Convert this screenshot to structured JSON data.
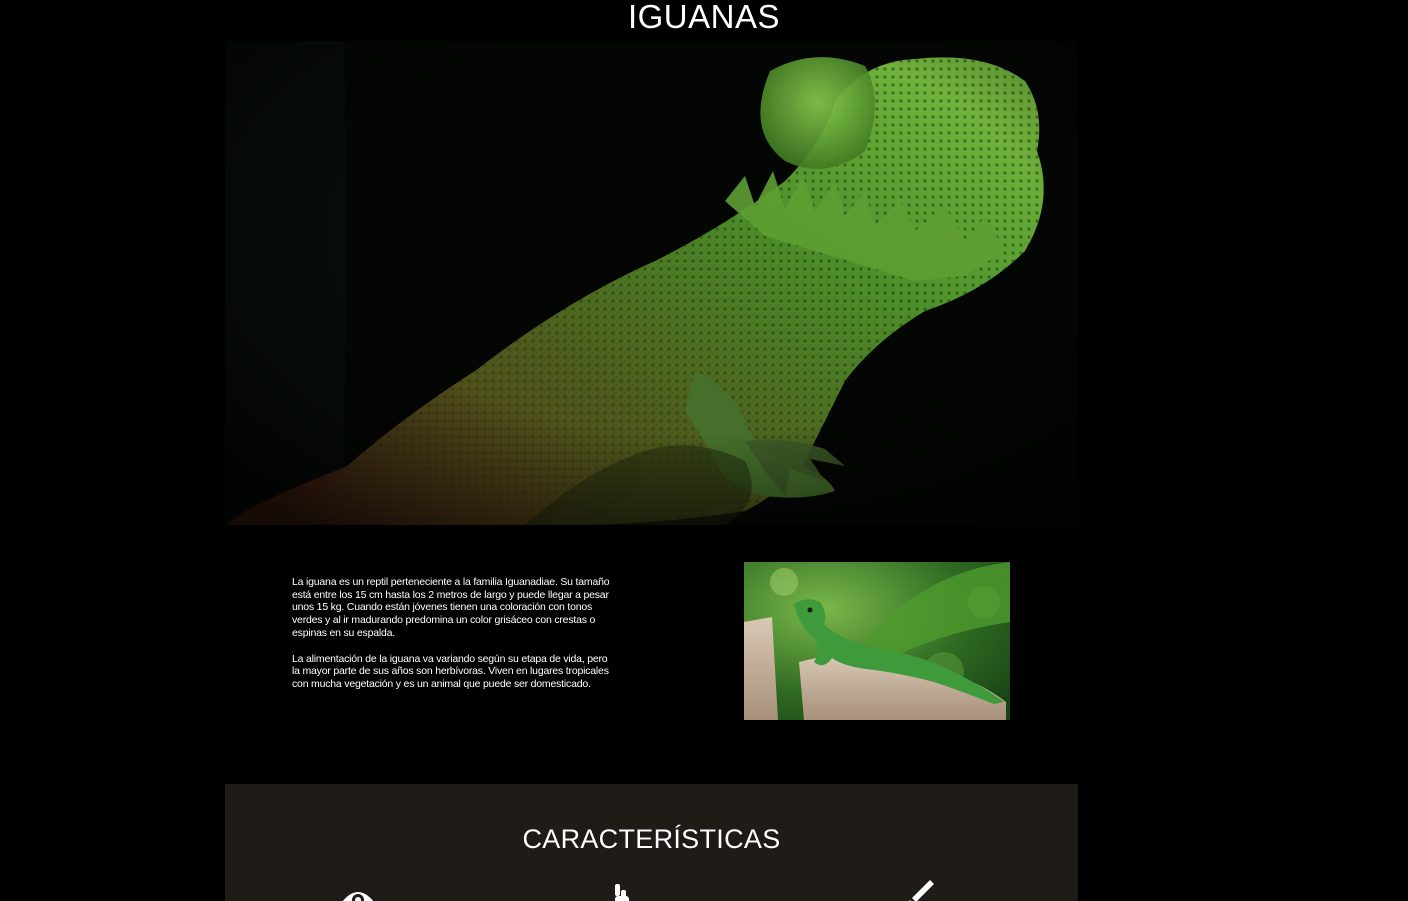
{
  "header": {
    "title": "IGUANAS"
  },
  "intro": {
    "paragraph_1": "La iguana es un reptil perteneciente a la familia Iguanadiae. Su tamaño está entre los 15 cm hasta los 2 metros de largo y puede llegar a pesar unos 15 kg. Cuando están jóvenes tienen una coloración con tonos verdes y al ir madurando predomina un color grisáceo con crestas o espinas en su espalda.",
    "paragraph_2": "La alimentación de la iguana va variando según su etapa de vida, pero la mayor parte de sus años son herbívoras. Viven en lugares tropicales con mucha vegetación y es un animal que puede ser domesticado."
  },
  "features": {
    "heading": "CARACTERÍSTICAS",
    "icons": [
      "eye-icon",
      "hand-icon",
      "brush-icon"
    ]
  },
  "colors": {
    "background": "#000000",
    "features_background": "#1f1b17",
    "text": "#ffffff",
    "iguana_green": "#5fae3a"
  }
}
